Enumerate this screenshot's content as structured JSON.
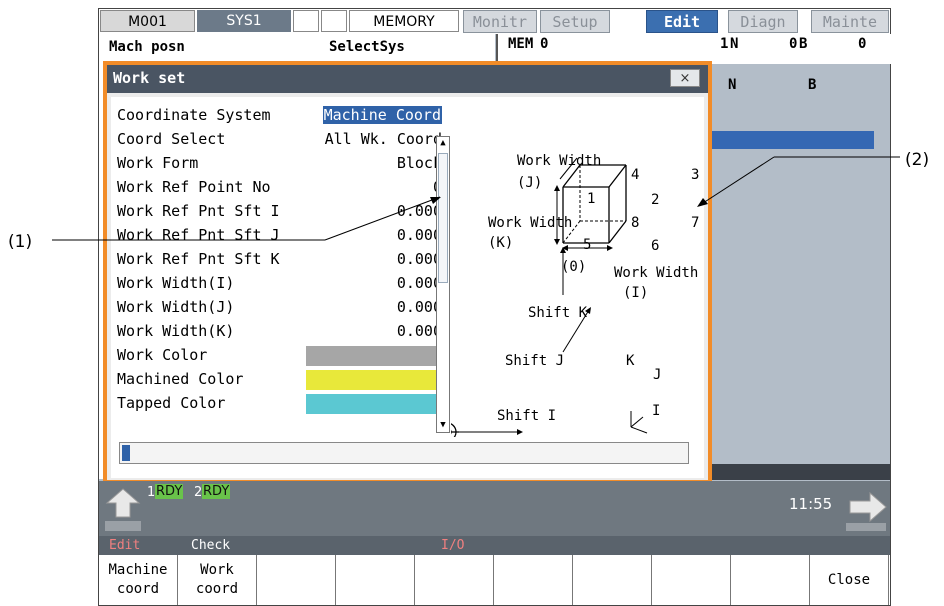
{
  "topbar": {
    "m001": "M001",
    "sys": "SYS1",
    "mode": "MEMORY",
    "tabs": [
      {
        "label": "Monitr",
        "active": false
      },
      {
        "label": "Setup",
        "active": false
      },
      {
        "label": "Edit",
        "active": true
      },
      {
        "label": "Diagn",
        "active": false
      },
      {
        "label": "Mainte",
        "active": false
      }
    ]
  },
  "background": {
    "left_title": "Mach posn",
    "left_sub": "SelectSys",
    "right_mem": "MEM",
    "right_zero": "0",
    "right_row1": [
      "1",
      "N",
      "0",
      "B",
      "0"
    ],
    "right_row2": [
      "N",
      "B"
    ]
  },
  "dialog": {
    "title": "Work set",
    "close_label": "×",
    "rows": [
      {
        "label": "Coordinate System",
        "value": "Machine Coord",
        "selected": true
      },
      {
        "label": "Coord Select",
        "value": "All Wk. Coord"
      },
      {
        "label": "Work Form",
        "value": "Block"
      },
      {
        "label": "Work Ref Point No",
        "value": "0"
      },
      {
        "label": "Work Ref Pnt Sft I",
        "value": "0.000"
      },
      {
        "label": "Work Ref Pnt Sft J",
        "value": "0.000"
      },
      {
        "label": "Work Ref Pnt Sft K",
        "value": "0.000"
      },
      {
        "label": "Work Width(I)",
        "value": "0.000"
      },
      {
        "label": "Work Width(J)",
        "value": "0.000"
      },
      {
        "label": "Work Width(K)",
        "value": "0.000"
      },
      {
        "label": "Work Color",
        "color": "#a6a6a6"
      },
      {
        "label": "Machined Color",
        "color": "#e8e83a"
      },
      {
        "label": "Tapped Color",
        "color": "#5bc8d2"
      }
    ],
    "scroll_up": "▲",
    "scroll_down": "▼",
    "progress": 0.015
  },
  "diagram": {
    "work_width_j": "Work Width",
    "j_paren": "(J)",
    "work_width_k": "Work Width",
    "k_paren": "(K)",
    "work_width_i": "Work Width",
    "i_paren": "(I)",
    "n1": "1",
    "n2": "2",
    "n3": "3",
    "n4": "4",
    "n5": "5",
    "n6": "6",
    "n7": "7",
    "n8": "8",
    "n0": "(0)",
    "shift_k": "Shift K",
    "shift_j": "Shift J",
    "shift_i": "Shift I",
    "axis_k": "K",
    "axis_j": "J",
    "axis_i": "I"
  },
  "status": {
    "rdy1_num": "1",
    "rdy1": "RDY",
    "rdy2_num": "2",
    "rdy2": "RDY",
    "clock": "11:55"
  },
  "menu": {
    "edit": "Edit",
    "check": "Check",
    "io": "I/O"
  },
  "softkeys": [
    {
      "l1": "Machine",
      "l2": "coord"
    },
    {
      "l1": "Work",
      "l2": "coord"
    },
    {
      "l1": "",
      "l2": ""
    },
    {
      "l1": "",
      "l2": ""
    },
    {
      "l1": "",
      "l2": ""
    },
    {
      "l1": "",
      "l2": ""
    },
    {
      "l1": "",
      "l2": ""
    },
    {
      "l1": "",
      "l2": ""
    },
    {
      "l1": "",
      "l2": ""
    },
    {
      "l1": "Close",
      "l2": ""
    }
  ],
  "callouts": {
    "c1": "(1)",
    "c2": "(2)"
  }
}
